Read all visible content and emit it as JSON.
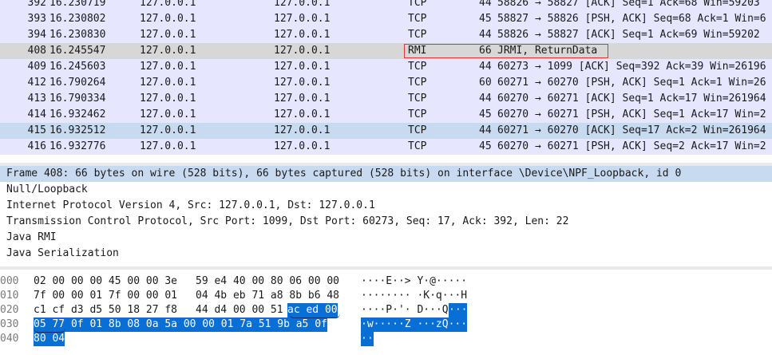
{
  "colors": {
    "row_default": "#ffffff",
    "row_tcp": "#e7e6ff",
    "row_selected_grey": "#d7d7d7",
    "row_blue": "#c8daf0",
    "byte_selection": "#0a6fd4",
    "annotation_box": "#d93838"
  },
  "packet_list": {
    "rows": [
      {
        "no": "392",
        "time": "16.230719",
        "src": "127.0.0.1",
        "dst": "127.0.0.1",
        "proto": "TCP",
        "len": "44",
        "info": "58826 → 58827 [ACK] Seq=1 Ack=68 Win=59203",
        "style": "tcp"
      },
      {
        "no": "393",
        "time": "16.230802",
        "src": "127.0.0.1",
        "dst": "127.0.0.1",
        "proto": "TCP",
        "len": "45",
        "info": "58827 → 58826 [PSH, ACK] Seq=68 Ack=1 Win=6",
        "style": "tcp"
      },
      {
        "no": "394",
        "time": "16.230830",
        "src": "127.0.0.1",
        "dst": "127.0.0.1",
        "proto": "TCP",
        "len": "44",
        "info": "58826 → 58827 [ACK] Seq=1 Ack=69 Win=59202",
        "style": "tcp"
      },
      {
        "no": "408",
        "time": "16.245547",
        "src": "127.0.0.1",
        "dst": "127.0.0.1",
        "proto": "RMI",
        "len": "66",
        "info": "JRMI, ReturnData",
        "style": "selected"
      },
      {
        "no": "409",
        "time": "16.245603",
        "src": "127.0.0.1",
        "dst": "127.0.0.1",
        "proto": "TCP",
        "len": "44",
        "info": "60273 → 1099 [ACK] Seq=392 Ack=39 Win=26196",
        "style": "tcp"
      },
      {
        "no": "412",
        "time": "16.790264",
        "src": "127.0.0.1",
        "dst": "127.0.0.1",
        "proto": "TCP",
        "len": "60",
        "info": "60271 → 60270 [PSH, ACK] Seq=1 Ack=1 Win=26",
        "style": "tcp"
      },
      {
        "no": "413",
        "time": "16.790334",
        "src": "127.0.0.1",
        "dst": "127.0.0.1",
        "proto": "TCP",
        "len": "44",
        "info": "60270 → 60271 [ACK] Seq=1 Ack=17 Win=261964",
        "style": "tcp"
      },
      {
        "no": "414",
        "time": "16.932462",
        "src": "127.0.0.1",
        "dst": "127.0.0.1",
        "proto": "TCP",
        "len": "45",
        "info": "60270 → 60271 [PSH, ACK] Seq=1 Ack=17 Win=2",
        "style": "tcp"
      },
      {
        "no": "415",
        "time": "16.932512",
        "src": "127.0.0.1",
        "dst": "127.0.0.1",
        "proto": "TCP",
        "len": "44",
        "info": "60271 → 60270 [ACK] Seq=17 Ack=2 Win=261964",
        "style": "blue"
      },
      {
        "no": "416",
        "time": "16.932776",
        "src": "127.0.0.1",
        "dst": "127.0.0.1",
        "proto": "TCP",
        "len": "45",
        "info": "60270 → 60271 [PSH, ACK] Seq=2 Ack=17 Win=2",
        "style": "tcp"
      }
    ]
  },
  "details": {
    "frame": "Frame 408: 66 bytes on wire (528 bits), 66 bytes captured (528 bits) on interface \\Device\\NPF_Loopback, id 0",
    "null_loopback": "Null/Loopback",
    "ip": "Internet Protocol Version 4, Src: 127.0.0.1, Dst: 127.0.0.1",
    "tcp": "Transmission Control Protocol, Src Port: 1099, Dst Port: 60273, Seq: 17, Ack: 392, Len: 22",
    "rmi": "Java RMI",
    "serialization": "Java Serialization"
  },
  "bytes": {
    "lines": [
      {
        "offset": "000",
        "hex_a": "02 00 00 00 45 00 00 3e",
        "hex_b": "59 e4 40 00 80 06 00 00",
        "ascii": "····E··> Y·@·····",
        "sel_from": null
      },
      {
        "offset": "010",
        "hex_a": "7f 00 00 01 7f 00 00 01",
        "hex_b": "04 4b eb 71 a8 8b b6 48",
        "ascii": "········ ·K·q···H",
        "sel_from": null
      },
      {
        "offset": "020",
        "hex_a": "c1 cf d3 d5 50 18 27 f8",
        "hex_b": "44 d4 00 00 51",
        "hex_sel": "ac ed 00",
        "ascii": "····P·'· D···Q",
        "ascii_sel": "···"
      },
      {
        "offset": "030",
        "hex_sel": "05 77 0f 01 8b 08 0a 5a  00 00 01 7a 51 9b a5 0f",
        "ascii_sel": "·w·····Z ···zQ···"
      },
      {
        "offset": "040",
        "hex_sel": "80 04",
        "ascii_sel": "··"
      }
    ]
  }
}
